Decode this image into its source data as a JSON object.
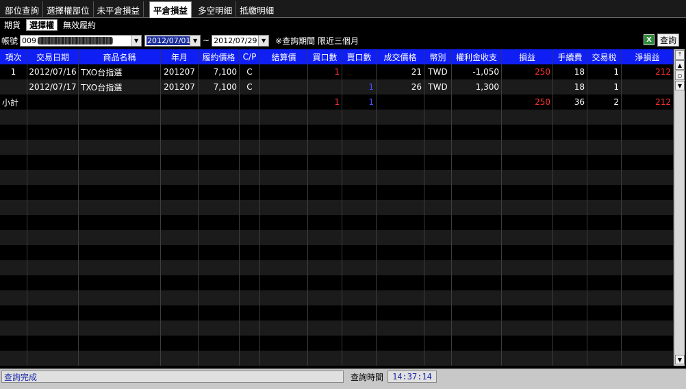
{
  "tabs": [
    "部位查詢",
    "選擇權部位",
    "未平倉損益",
    "平倉損益",
    "多空明細",
    "抵繳明細"
  ],
  "active_tab": 3,
  "subtabs": [
    "期貨",
    "選擇權",
    "無效履約"
  ],
  "active_subtab": 1,
  "query": {
    "account_label": "帳號",
    "account_value": "009",
    "date_from": "2012/07/01",
    "date_sep": "~",
    "date_to": "2012/07/29",
    "note": "※查詢期間 限近三個月",
    "query_button": "查詢",
    "excel_icon": "excel-icon"
  },
  "table": {
    "columns": [
      "項次",
      "交易日期",
      "商品名稱",
      "年月",
      "履約價格",
      "C/P",
      "結算價",
      "買口數",
      "賣口數",
      "成交價格",
      "幣別",
      "權利金收支",
      "損益",
      "手續費",
      "交易稅",
      "淨損益"
    ],
    "rows": [
      [
        "1",
        "2012/07/16",
        "TXO台指選",
        "201207",
        "7,100",
        "C",
        "",
        "1",
        "",
        "21",
        "TWD",
        "-1,050",
        "250",
        "18",
        "1",
        "212"
      ],
      [
        "",
        "2012/07/17",
        "TXO台指選",
        "201207",
        "7,100",
        "C",
        "",
        "",
        "1",
        "26",
        "TWD",
        "1,300",
        "",
        "18",
        "1",
        ""
      ],
      [
        "小計",
        "",
        "",
        "",
        "",
        "",
        "",
        "1",
        "1",
        "",
        "",
        "",
        "250",
        "36",
        "2",
        "212"
      ]
    ]
  },
  "colors": {
    "header_bg": "#0f1ff3",
    "profit": "#ff3030",
    "sell": "#5050ff"
  },
  "status": {
    "message": "查詢完成",
    "time_label": "查詢時間",
    "time_value": "14:37:14"
  }
}
